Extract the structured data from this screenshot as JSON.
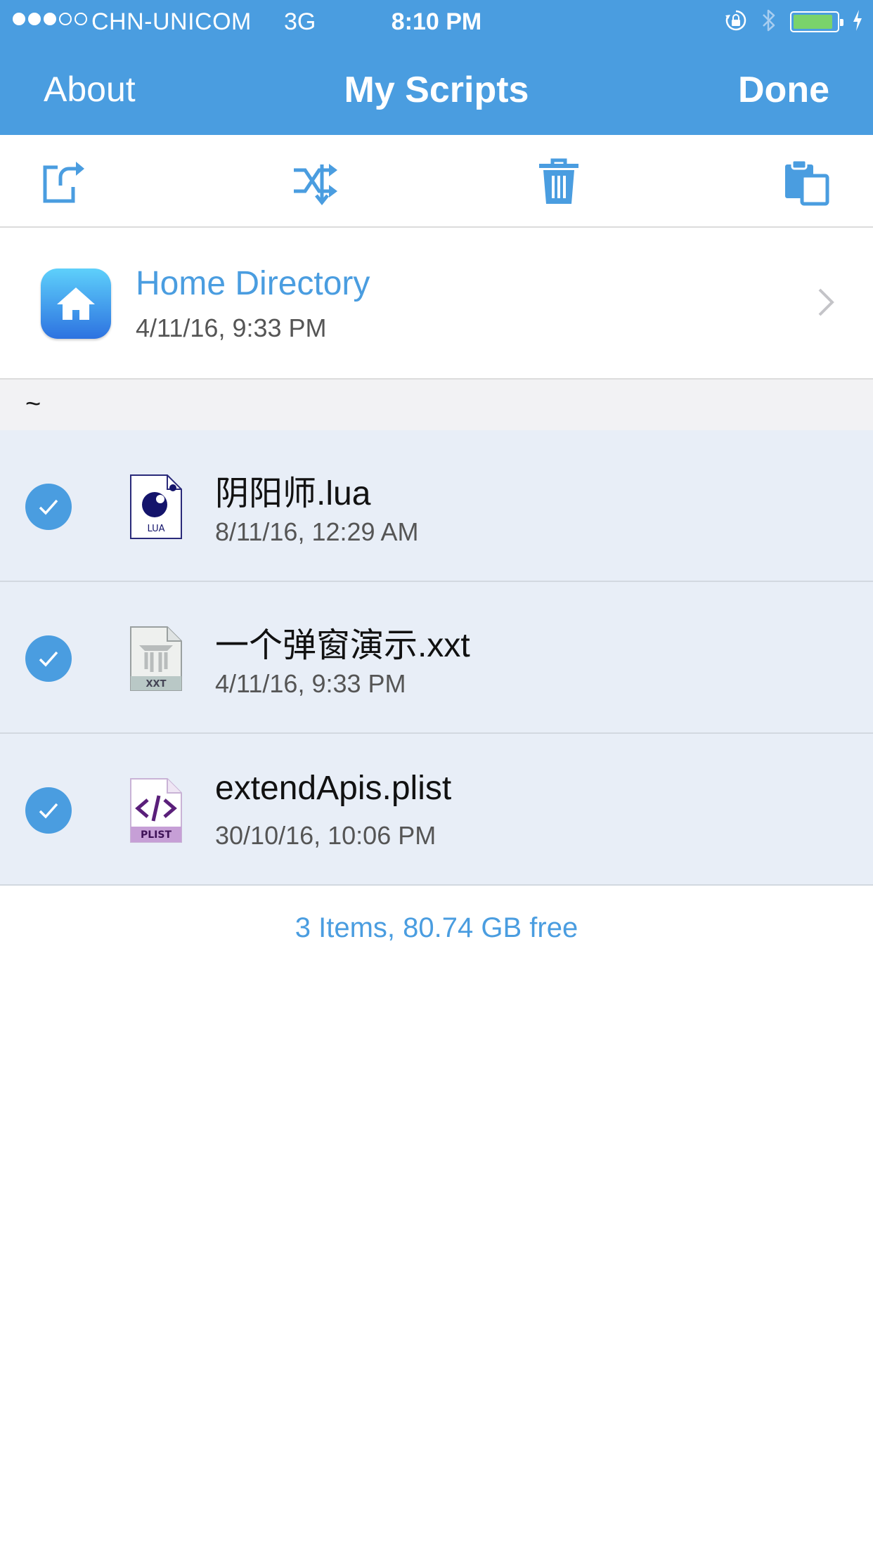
{
  "status_bar": {
    "carrier": "CHN-UNICOM",
    "network": "3G",
    "time": "8:10 PM",
    "signal_bars_filled": 3,
    "signal_bars_total": 5,
    "battery_level": 0.92
  },
  "nav": {
    "left_label": "About",
    "title": "My Scripts",
    "right_label": "Done",
    "background": "#4a9de0"
  },
  "toolbar": {
    "icons": [
      "share-icon",
      "shuffle-icon",
      "trash-icon",
      "paste-icon"
    ]
  },
  "home": {
    "title": "Home Directory",
    "date": "4/11/16, 9:33 PM"
  },
  "section": {
    "title": "~"
  },
  "files": [
    {
      "name": "阴阳师.lua",
      "date": "8/11/16, 12:29 AM",
      "type_label": "LUA",
      "selected": true
    },
    {
      "name": "一个弹窗演示.xxt",
      "date": "4/11/16, 9:33 PM",
      "type_label": "XXT",
      "selected": true
    },
    {
      "name": "extendApis.plist",
      "date": "30/10/16, 10:06 PM",
      "type_label": "PLIST",
      "selected": true
    }
  ],
  "footer": {
    "summary": "3 Items, 80.74 GB free"
  },
  "colors": {
    "accent": "#4a9de0",
    "selected_row": "#e8eef7"
  }
}
